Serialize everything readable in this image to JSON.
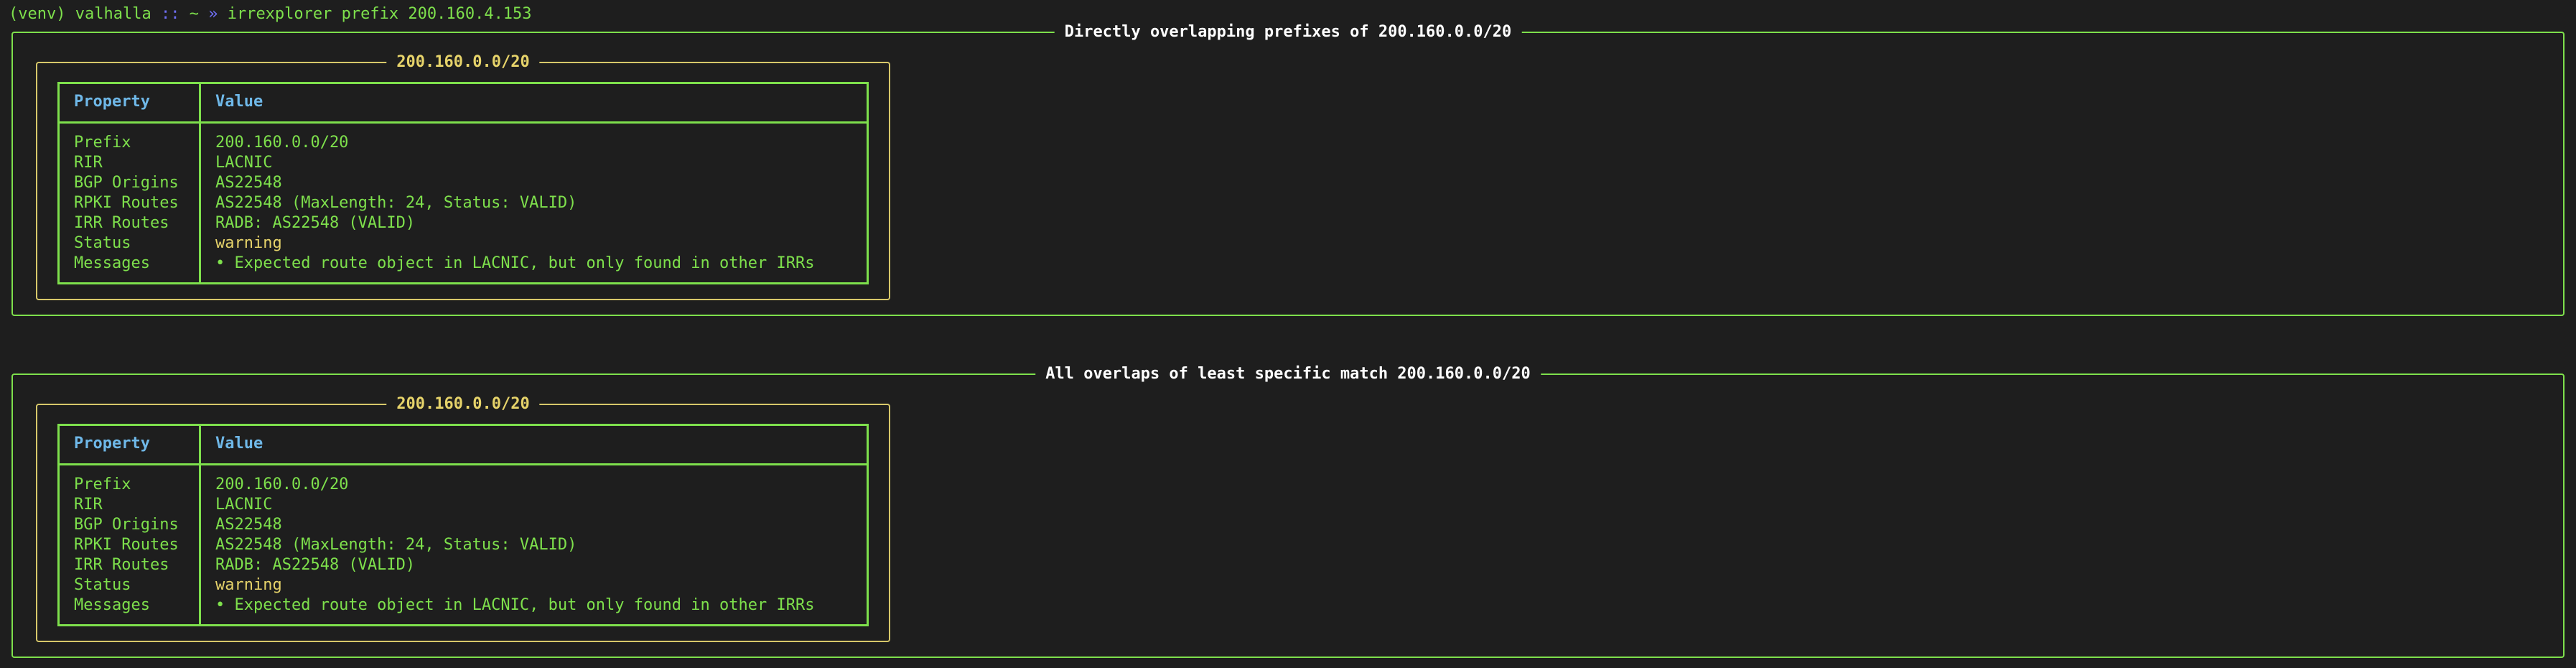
{
  "terminal": {
    "prompt": {
      "venv": "(venv)",
      "host": "valhalla",
      "separator": "::",
      "cwd": "~",
      "arrow": "»",
      "command": "irrexplorer prefix 200.160.4.153"
    },
    "colors": {
      "background": "#1e1e1e",
      "text_green": "#7ee04c",
      "header_blue": "#6fb8e8",
      "warning_yellow": "#e6d36a",
      "title_white": "#ffffff",
      "prompt_purple": "#6f6ff5"
    }
  },
  "sections": [
    {
      "title": "Directly overlapping prefixes of 200.160.0.0/20",
      "panel_title": "200.160.0.0/20",
      "headers": {
        "property": "Property",
        "value": "Value"
      },
      "rows": [
        {
          "property": "Prefix",
          "value": "200.160.0.0/20"
        },
        {
          "property": "RIR",
          "value": "LACNIC"
        },
        {
          "property": "BGP Origins",
          "value": "AS22548"
        },
        {
          "property": "RPKI Routes",
          "value": "AS22548 (MaxLength: 24, Status: VALID)"
        },
        {
          "property": "IRR Routes",
          "value": "RADB: AS22548 (VALID)"
        },
        {
          "property": "Status",
          "value": "warning"
        },
        {
          "property": "Messages",
          "value": "• Expected route object in LACNIC, but only found in other IRRs"
        }
      ]
    },
    {
      "title": "All overlaps of least specific match 200.160.0.0/20",
      "panel_title": "200.160.0.0/20",
      "headers": {
        "property": "Property",
        "value": "Value"
      },
      "rows": [
        {
          "property": "Prefix",
          "value": "200.160.0.0/20"
        },
        {
          "property": "RIR",
          "value": "LACNIC"
        },
        {
          "property": "BGP Origins",
          "value": "AS22548"
        },
        {
          "property": "RPKI Routes",
          "value": "AS22548 (MaxLength: 24, Status: VALID)"
        },
        {
          "property": "IRR Routes",
          "value": "RADB: AS22548 (VALID)"
        },
        {
          "property": "Status",
          "value": "warning"
        },
        {
          "property": "Messages",
          "value": "• Expected route object in LACNIC, but only found in other IRRs"
        }
      ]
    }
  ]
}
